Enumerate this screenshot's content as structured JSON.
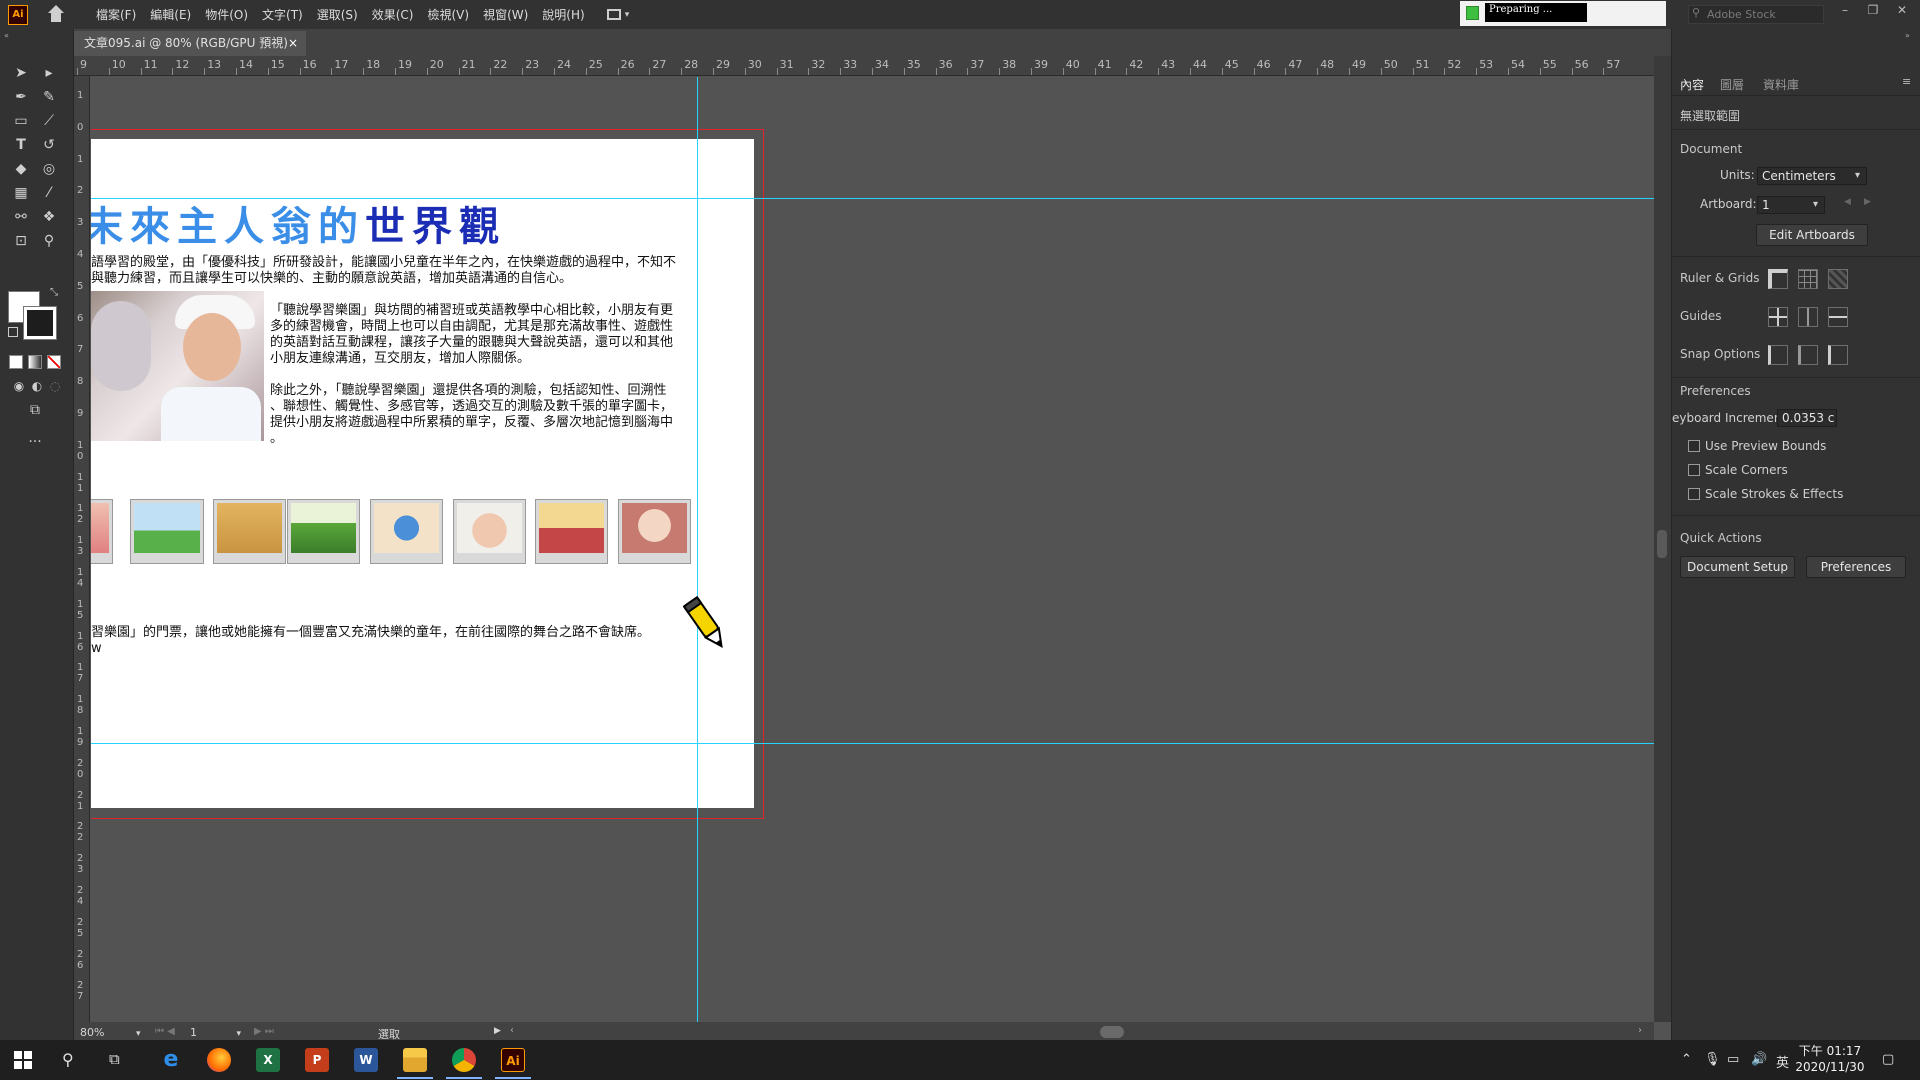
{
  "menu": {
    "logo": "Ai",
    "items": [
      "檔案(F)",
      "編輯(E)",
      "物件(O)",
      "文字(T)",
      "選取(S)",
      "效果(C)",
      "檢視(V)",
      "視窗(W)",
      "說明(H)"
    ]
  },
  "progress": {
    "label": "Preparing ..."
  },
  "stock_search": {
    "placeholder": "Adobe Stock"
  },
  "document_tab": {
    "title": "文章095.ai @ 80% (RGB/GPU 預視)",
    "close": "×"
  },
  "ruler_top": [
    "9",
    "10",
    "11",
    "12",
    "13",
    "14",
    "15",
    "16",
    "17",
    "18",
    "19",
    "20",
    "21",
    "22",
    "23",
    "24",
    "25",
    "26",
    "27",
    "28",
    "29",
    "30",
    "31",
    "32",
    "33",
    "34",
    "35",
    "36",
    "37",
    "38",
    "39",
    "40",
    "41",
    "42",
    "43",
    "44",
    "45",
    "46",
    "47",
    "48",
    "49",
    "50",
    "51",
    "52",
    "53",
    "54",
    "55",
    "56",
    "57"
  ],
  "ruler_left": [
    "1",
    "0",
    "1",
    "2",
    "3",
    "4",
    "5",
    "6",
    "7",
    "8",
    "9",
    "10",
    "11",
    "12",
    "13",
    "14",
    "15",
    "16",
    "17",
    "18",
    "19",
    "20",
    "21",
    "22",
    "23",
    "24",
    "25",
    "26",
    "27"
  ],
  "artwork": {
    "headline_light": "末來主人翁的",
    "headline_dark": "世界觀",
    "intro_line1": "語學習的殿堂，由「優優科技」所研發設計，能讓國小兒童在半年之內，在快樂遊戲的過程中，不知不",
    "intro_line2": "與聽力練習，而且讓學生可以快樂的、主動的願意說英語，增加英語溝通的自信心。",
    "para2": [
      "「聽說學習樂園」與坊間的補習班或英語教學中心相比較，小朋友有更",
      "多的練習機會，時間上也可以自由調配，尤其是那充滿故事性、遊戲性",
      "的英語對話互動課程，讓孩子大量的跟聽與大聲說英語，還可以和其他",
      "小朋友連線溝通，互交朋友，增加人際關係。"
    ],
    "para3": [
      "除此之外，「聽說學習樂園」還提供各項的測驗，包括認知性、回溯性",
      "、聯想性、觸覺性、多感官等，透過交互的測驗及數千張的單字圖卡，",
      "提供小朋友將遊戲過程中所累積的單字，反覆、多層次地記憶到腦海中",
      "。"
    ],
    "footer_line1": "習樂園」的門票，讓他或她能擁有一個豐富又充滿快樂的童年，在前往國際的舞台之路不會缺席。",
    "footer_line2": "w"
  },
  "status": {
    "zoom": "80%",
    "artboard": "1",
    "label": "選取"
  },
  "panel": {
    "tabs": [
      "內容",
      "圖層",
      "資料庫"
    ],
    "no_selection": "無選取範圍",
    "document_section": "Document",
    "units_label": "Units:",
    "units_value": "Centimeters",
    "artboard_label": "Artboard:",
    "artboard_value": "1",
    "edit_artboards": "Edit Artboards",
    "ruler_grids": "Ruler & Grids",
    "guides": "Guides",
    "snap_options": "Snap Options",
    "preferences_section": "Preferences",
    "keyboard_increment_label": "eyboard Increment:",
    "keyboard_increment_value": "0.0353 c",
    "use_preview_bounds": "Use Preview Bounds",
    "scale_corners": "Scale Corners",
    "scale_strokes": "Scale Strokes & Effects",
    "quick_actions": "Quick Actions",
    "document_setup": "Document Setup",
    "preferences_btn": "Preferences"
  },
  "taskbar": {
    "clock_time": "下午 01:17",
    "clock_date": "2020/11/30",
    "ime": "英"
  }
}
